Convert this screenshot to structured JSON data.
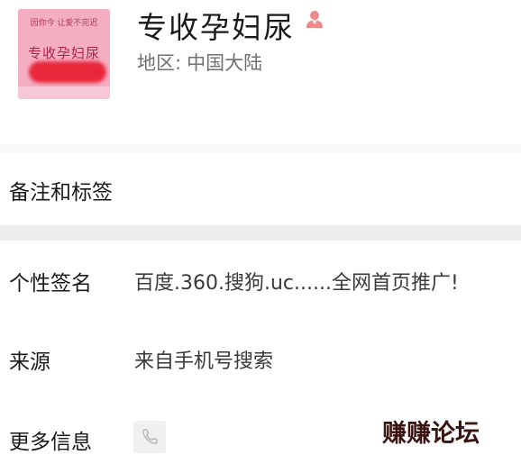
{
  "profile": {
    "avatar": {
      "top_text": "因你今 让爱不完迟",
      "main_text": "专收孕妇尿"
    },
    "nickname": "专收孕妇尿",
    "region_label": "地区:",
    "region_value": "中国大陆",
    "gender_icon": "female-user-icon",
    "gender_color": "#f08a8a"
  },
  "rows": {
    "remarks": {
      "label": "备注和标签"
    },
    "signature": {
      "label": "个性签名",
      "value": "百度.360.搜狗.uc......全网首页推广!"
    },
    "source": {
      "label": "来源",
      "value": "来自手机号搜索"
    },
    "more": {
      "label": "更多信息",
      "icon": "phone-icon"
    }
  },
  "watermark": "赚赚论坛",
  "colors": {
    "separator": "#ededed",
    "avatar_background": "#f3aec2",
    "avatar_text": "#b0224a",
    "redaction": "#e8273a"
  }
}
